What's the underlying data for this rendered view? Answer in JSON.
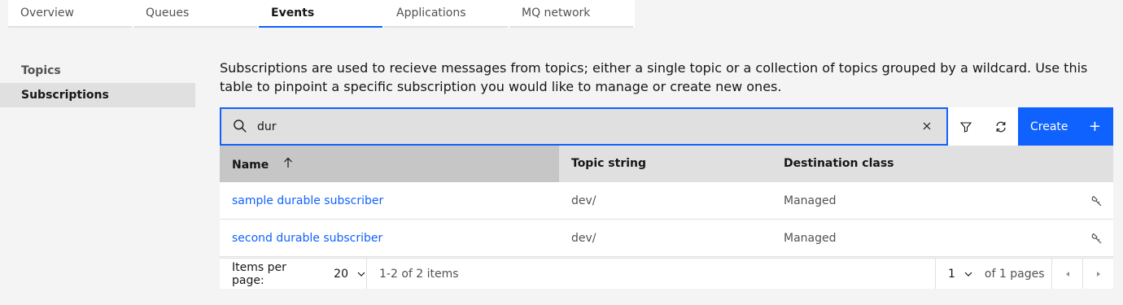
{
  "tabs": [
    "Overview",
    "Queues",
    "Events",
    "Applications",
    "MQ network"
  ],
  "active_tab": "Events",
  "sidenav": {
    "items": [
      "Topics",
      "Subscriptions"
    ],
    "active": "Subscriptions"
  },
  "description": "Subscriptions are used to recieve messages from topics; either a single topic or a collection of topics grouped by a wildcard. Use this table to pinpoint a specific subscription you would like to manage or create new ones.",
  "search": {
    "value": "dur"
  },
  "toolbar": {
    "create_label": "Create"
  },
  "table": {
    "headers": {
      "name": "Name",
      "topic": "Topic string",
      "dest": "Destination class"
    },
    "rows": [
      {
        "name": "sample durable subscriber",
        "topic": "dev/",
        "dest": "Managed"
      },
      {
        "name": "second durable subscriber",
        "topic": "dev/",
        "dest": "Managed"
      }
    ]
  },
  "pagination": {
    "items_per_page_label": "Items per page:",
    "items_per_page": "20",
    "range": "1-2 of 2 items",
    "page": "1",
    "of_pages": "of 1 pages"
  },
  "colors": {
    "accent": "#0f62fe",
    "background": "#f4f4f4"
  }
}
